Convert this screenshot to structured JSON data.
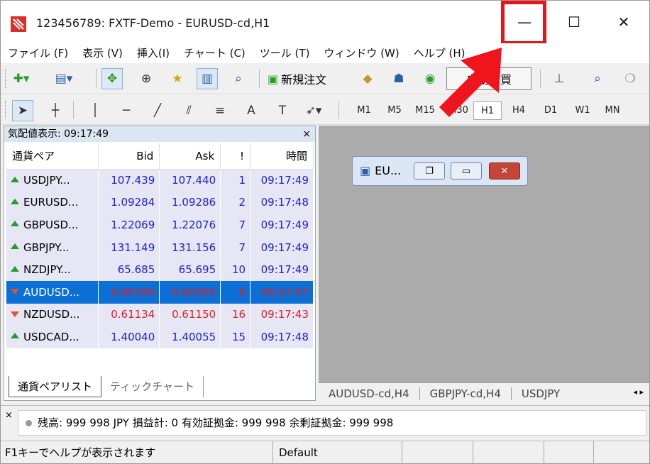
{
  "window": {
    "title": "123456789: FXTF-Demo - EURUSD-cd,H1",
    "controls": {
      "minimize": "—",
      "maximize": "☐",
      "close": "✕"
    }
  },
  "menu": [
    "ファイル (F)",
    "表示 (V)",
    "挿入(I)",
    "チャート (C)",
    "ツール (T)",
    "ウィンドウ (W)",
    "ヘルプ (H)"
  ],
  "toolbar": {
    "new_order": "新規注文",
    "auto_trade": "自動売買",
    "timeframes": [
      "M1",
      "M5",
      "M15",
      "M30",
      "H1",
      "H4",
      "D1",
      "W1",
      "MN"
    ],
    "active_timeframe": "H1"
  },
  "market_watch": {
    "title": "気配値表示: 09:17:49",
    "close": "×",
    "columns": [
      "通貨ペア",
      "Bid",
      "Ask",
      "!",
      "時間"
    ],
    "rows": [
      {
        "symbol": "USDJPY...",
        "bid": "107.439",
        "ask": "107.440",
        "spread": "1",
        "time": "09:17:49",
        "dir": "up"
      },
      {
        "symbol": "EURUSD...",
        "bid": "1.09284",
        "ask": "1.09286",
        "spread": "2",
        "time": "09:17:48",
        "dir": "up"
      },
      {
        "symbol": "GBPUSD...",
        "bid": "1.22069",
        "ask": "1.22076",
        "spread": "7",
        "time": "09:17:49",
        "dir": "up"
      },
      {
        "symbol": "GBPJPY...",
        "bid": "131.149",
        "ask": "131.156",
        "spread": "7",
        "time": "09:17:49",
        "dir": "up"
      },
      {
        "symbol": "NZDJPY...",
        "bid": "65.685",
        "ask": "65.695",
        "spread": "10",
        "time": "09:17:49",
        "dir": "up"
      },
      {
        "symbol": "AUDUSD...",
        "bid": "0.65349",
        "ask": "0.65355",
        "spread": "6",
        "time": "09:17:47",
        "dir": "down",
        "selected": true
      },
      {
        "symbol": "NZDUSD...",
        "bid": "0.61134",
        "ask": "0.61150",
        "spread": "16",
        "time": "09:17:43",
        "dir": "down"
      },
      {
        "symbol": "USDCAD...",
        "bid": "1.40040",
        "ask": "1.40055",
        "spread": "15",
        "time": "09:17:48",
        "dir": "up"
      }
    ],
    "tabs": [
      "通貨ペアリスト",
      "ティックチャート"
    ]
  },
  "minimized_chart": {
    "title": "EU..."
  },
  "chart_tabs": [
    "AUDUSD-cd,H4",
    "GBPJPY-cd,H4",
    "USDJPY"
  ],
  "terminal": {
    "close": "×",
    "balance_line": "残高: 999 998 JPY  損益計: 0  有効証拠金: 999 998  余剰証拠金: 999 998"
  },
  "status": {
    "help": "F1キーでヘルプが表示されます",
    "profile": "Default"
  },
  "colors": {
    "highlight_box": "#e8141c",
    "selected_row": "#0b6fd6",
    "bid_up": "#1f1fd4",
    "bid_down": "#e02020"
  }
}
